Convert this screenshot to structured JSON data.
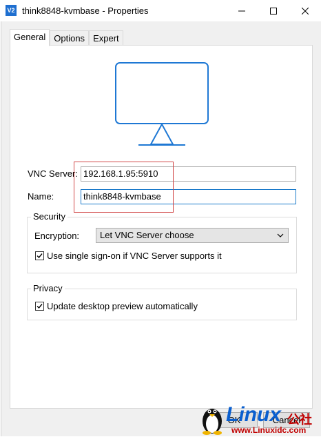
{
  "window": {
    "app_icon_text": "V2",
    "title": "think8848-kvmbase - Properties",
    "minimize_icon": "minimize-icon",
    "maximize_icon": "maximize-icon",
    "close_icon": "close-icon"
  },
  "tabs": [
    {
      "label": "General",
      "active": true
    },
    {
      "label": "Options",
      "active": false
    },
    {
      "label": "Expert",
      "active": false
    }
  ],
  "general": {
    "preview_icon": "monitor-icon",
    "vnc_server_label": "VNC Server:",
    "vnc_server_value": "192.168.1.95:5910",
    "name_label": "Name:",
    "name_value": "think8848-kvmbase",
    "security": {
      "title": "Security",
      "encryption_label": "Encryption:",
      "encryption_value": "Let VNC Server choose",
      "sso_label": "Use single sign-on if VNC Server supports it",
      "sso_checked": true
    },
    "privacy": {
      "title": "Privacy",
      "preview_label": "Update desktop preview automatically",
      "preview_checked": true
    }
  },
  "buttons": {
    "ok": "OK",
    "cancel": "Cancel"
  },
  "watermark": {
    "brand": "Linux",
    "brand_cn": "公社",
    "url": "www.Linuxidc.com"
  },
  "colors": {
    "accent": "#1979ca",
    "highlight_box": "#d14646",
    "watermark_blue": "#0a5fcf",
    "watermark_red": "#c00000"
  }
}
